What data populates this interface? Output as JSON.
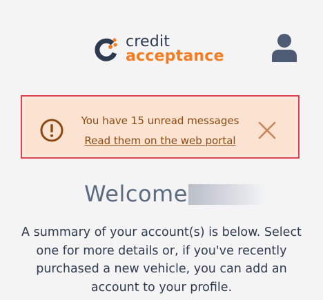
{
  "header": {
    "logo": {
      "line1": "credit",
      "line2": "acceptance",
      "brand_dark": "#2b3a4e",
      "brand_orange": "#f47b20"
    },
    "profile_icon": "user-avatar-icon"
  },
  "alert": {
    "message": "You have 15 unread messages",
    "link": "Read them on the web portal",
    "icon": "exclamation-circle-icon",
    "close_icon": "close-icon",
    "colors": {
      "background": "#fbe2d1",
      "text": "#8a4a12",
      "border": "#e0414f"
    }
  },
  "welcome": {
    "title": "Welcome"
  },
  "summary": {
    "text": "A summary of your account(s) is below. Select one for more details or, if you've recently purchased a new vehicle, you can add an account to your profile."
  }
}
